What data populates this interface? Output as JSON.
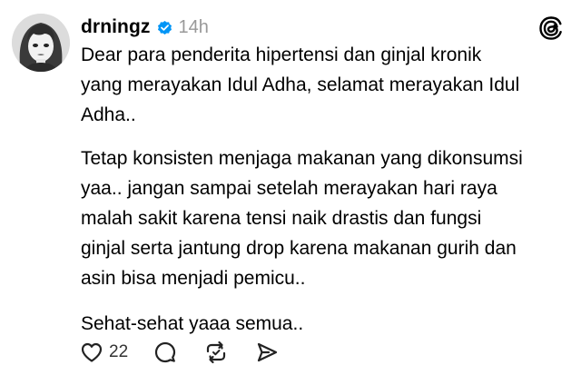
{
  "post": {
    "username": "drningz",
    "time": "14h",
    "paragraphs": [
      "Dear para penderita hipertensi dan ginjal kronik\nyang merayakan Idul Adha, selamat merayakan Idul\nAdha..",
      "Tetap konsisten menjaga makanan yang dikonsumsi\nyaa.. jangan sampai setelah merayakan hari raya\nmalah sakit karena tensi naik drastis dan fungsi\nginjal serta jantung drop karena makanan gurih dan\nasin bisa menjadi pemicu..",
      "Sehat-sehat yaaa semua.."
    ],
    "like_count": "22"
  },
  "icons": {
    "verified": "verified-badge-icon",
    "threads": "threads-logo-icon",
    "like": "heart-icon",
    "reply": "comment-icon",
    "repost": "repost-icon",
    "share": "send-icon"
  },
  "colors": {
    "verified": "#0095f6",
    "muted": "#999999",
    "text": "#000000"
  }
}
